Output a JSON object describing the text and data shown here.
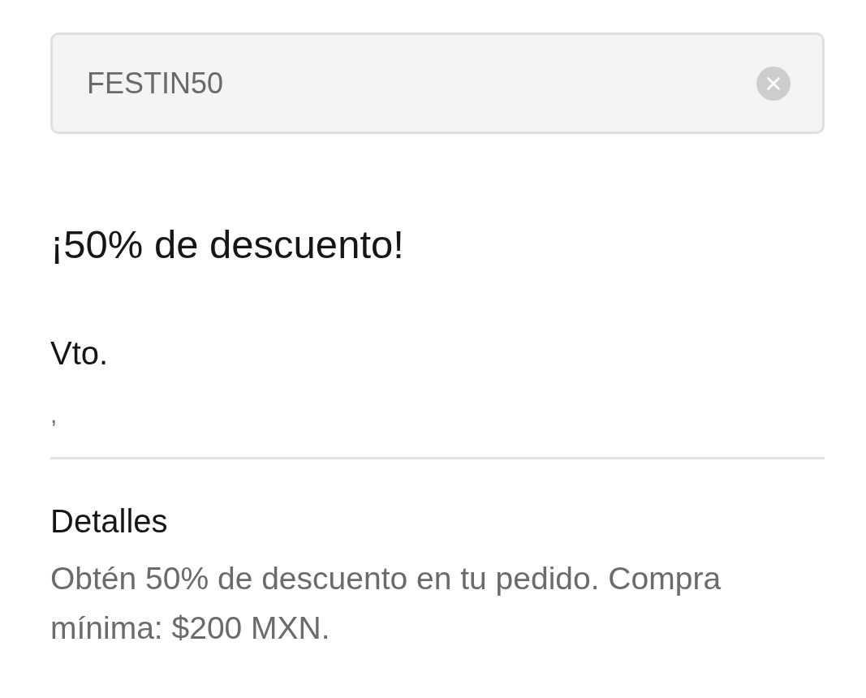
{
  "promo_field": {
    "value": "FESTIN50"
  },
  "title": "¡50% de descuento!",
  "expiry": {
    "label": "Vto.",
    "value": ","
  },
  "details": {
    "label": "Detalles",
    "text": "Obtén 50% de descuento en tu pedido. Compra mínima: $200 MXN."
  }
}
